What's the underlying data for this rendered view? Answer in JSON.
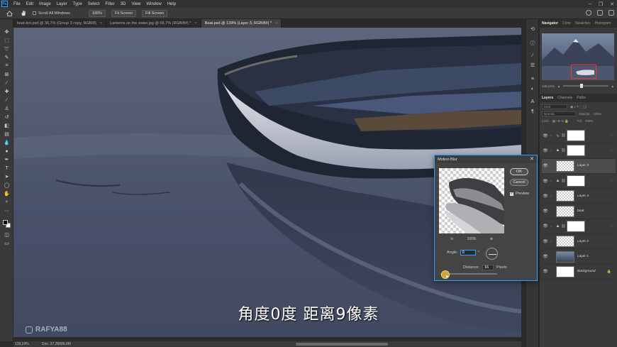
{
  "menubar": {
    "app_icon": "Ps",
    "items": [
      "File",
      "Edit",
      "Image",
      "Layer",
      "Type",
      "Select",
      "Filter",
      "3D",
      "View",
      "Window",
      "Help"
    ]
  },
  "options": {
    "scroll_all_windows": "Scroll All Windows",
    "zoom_value": "100%",
    "fit_screen": "Fit Screen",
    "fill_screen": "Fill Screen"
  },
  "tabs": [
    {
      "label": "boat-tint.psd @ 36,7% (Group 3 copy, RGB/8)",
      "active": false
    },
    {
      "label": "Lanterns on the water.jpg @ 66,7% (RGB/8#) *",
      "active": false
    },
    {
      "label": "Boat.psd @ 139% (Layer 3, RGB/8#) *",
      "active": true
    }
  ],
  "canvas": {
    "subtitle": "角度0度  距离9像素",
    "watermark": "RAFYA88"
  },
  "status": {
    "zoom": "139,24%",
    "doc": "Doc: 37,2M/86,0M"
  },
  "navigator": {
    "tabs": [
      "Navigator",
      "Color",
      "Swatches",
      "Histogram"
    ],
    "zoom": "139,24%"
  },
  "layers_panel": {
    "tabs": [
      "Layers",
      "Channels",
      "Paths"
    ],
    "kind": "Kind",
    "blend_mode": "Normal",
    "opacity_label": "Opacity:",
    "opacity_value": "100%",
    "lock_label": "Lock:",
    "fill_label": "Fill:",
    "fill_value": "100%",
    "layers": [
      {
        "name": "",
        "adj": "curves-icon",
        "thumb": "white",
        "clip": true,
        "selected": false
      },
      {
        "name": "",
        "adj": "levels-icon",
        "thumb": "white",
        "clip": true,
        "selected": false
      },
      {
        "name": "Layer 3",
        "adj": "",
        "thumb": "checker",
        "clip": false,
        "selected": true
      },
      {
        "name": "",
        "adj": "levels-icon",
        "thumb": "white",
        "clip": true,
        "selected": false
      },
      {
        "name": "Layer 4",
        "adj": "",
        "thumb": "checker",
        "clip": true,
        "selected": false
      },
      {
        "name": "boat",
        "adj": "",
        "thumb": "checker",
        "clip": false,
        "selected": false
      },
      {
        "name": "",
        "adj": "levels-icon",
        "thumb": "white",
        "clip": true,
        "selected": false
      },
      {
        "name": "Layer 2",
        "adj": "",
        "thumb": "checker",
        "clip": true,
        "selected": false
      },
      {
        "name": "Layer 1",
        "adj": "",
        "thumb": "photo",
        "clip": false,
        "selected": false
      },
      {
        "name": "Background",
        "adj": "",
        "thumb": "white",
        "clip": false,
        "selected": false
      }
    ]
  },
  "dialog": {
    "title": "Motion Blur",
    "ok": "OK",
    "cancel": "Cancel",
    "preview": "Preview",
    "zoom": "100%",
    "angle_label": "Angle:",
    "angle_value": "0",
    "angle_unit": "°",
    "distance_label": "Distance:",
    "distance_value": "16",
    "distance_unit": "Pixels"
  }
}
